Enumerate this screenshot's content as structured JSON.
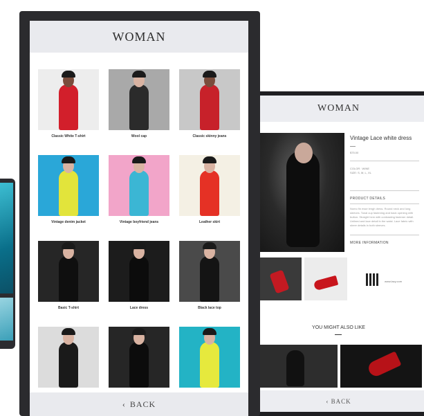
{
  "main_screen": {
    "title": "WOMAN",
    "back_label": "BACK",
    "back_chevron": "‹",
    "products": [
      {
        "caption": "Classic White T-shirt",
        "bg": "#ededed",
        "outfit": "#d21f2b",
        "skin": "dark"
      },
      {
        "caption": "Wool cap",
        "bg": "#a9a9a9",
        "outfit": "#2b2b2b",
        "skin": "light"
      },
      {
        "caption": "Classic skinny jeans",
        "bg": "#c8c8c8",
        "outfit": "#c7212a",
        "skin": "dark"
      },
      {
        "caption": "Vintage denim jacket",
        "bg": "#2aa7d8",
        "outfit": "#e2e43b",
        "skin": "light"
      },
      {
        "caption": "Vintage boyfriend jeans",
        "bg": "#f2a5c9",
        "outfit": "#3bb6d4",
        "skin": "light"
      },
      {
        "caption": "Leather skirt",
        "bg": "#f4f0e4",
        "outfit": "#e53125",
        "skin": "light"
      },
      {
        "caption": "Basic T-shirt",
        "bg": "#262626",
        "outfit": "#0f0f0f",
        "skin": "light"
      },
      {
        "caption": "Lace dress",
        "bg": "#1c1c1c",
        "outfit": "#0c0c0c",
        "skin": "light"
      },
      {
        "caption": "Black lace top",
        "bg": "#4a4a4a",
        "outfit": "#141414",
        "skin": "light"
      },
      {
        "caption": "",
        "bg": "#dcdcdc",
        "outfit": "#1a1a1a",
        "skin": "light"
      },
      {
        "caption": "",
        "bg": "#262626",
        "outfit": "#0c0c0c",
        "skin": "light"
      },
      {
        "caption": "",
        "bg": "#23b3c5",
        "outfit": "#e6e93d",
        "skin": "light"
      }
    ]
  },
  "detail_screen": {
    "title": "WOMAN",
    "product_name": "Vintage Lace white dress",
    "price": "$75.00",
    "color_label": "COLOR : WINE",
    "size_label": "SIZE: S, M, L, XL",
    "product_details_heading": "PRODUCT DETAILS",
    "product_details_text": "Nomo fin esse lengh dress. Round neck and long sleeves. Tonal cup fastening and back opening with button. Straight hem with contrasting fastener detail. Unlined and lace detail in the waist. Lace fabric with sheer details in both sleeves.",
    "more_info_heading": "MORE INFORMATION",
    "url": "www.lacy.com",
    "you_might_also_like": "YOU MIGHT ALSO LIKE",
    "back_label": "BACK",
    "back_chevron": "‹"
  },
  "colors": {
    "header_bg": "#e9eaee",
    "bezel": "#2b2b2e",
    "accent_red": "#c8151c"
  }
}
